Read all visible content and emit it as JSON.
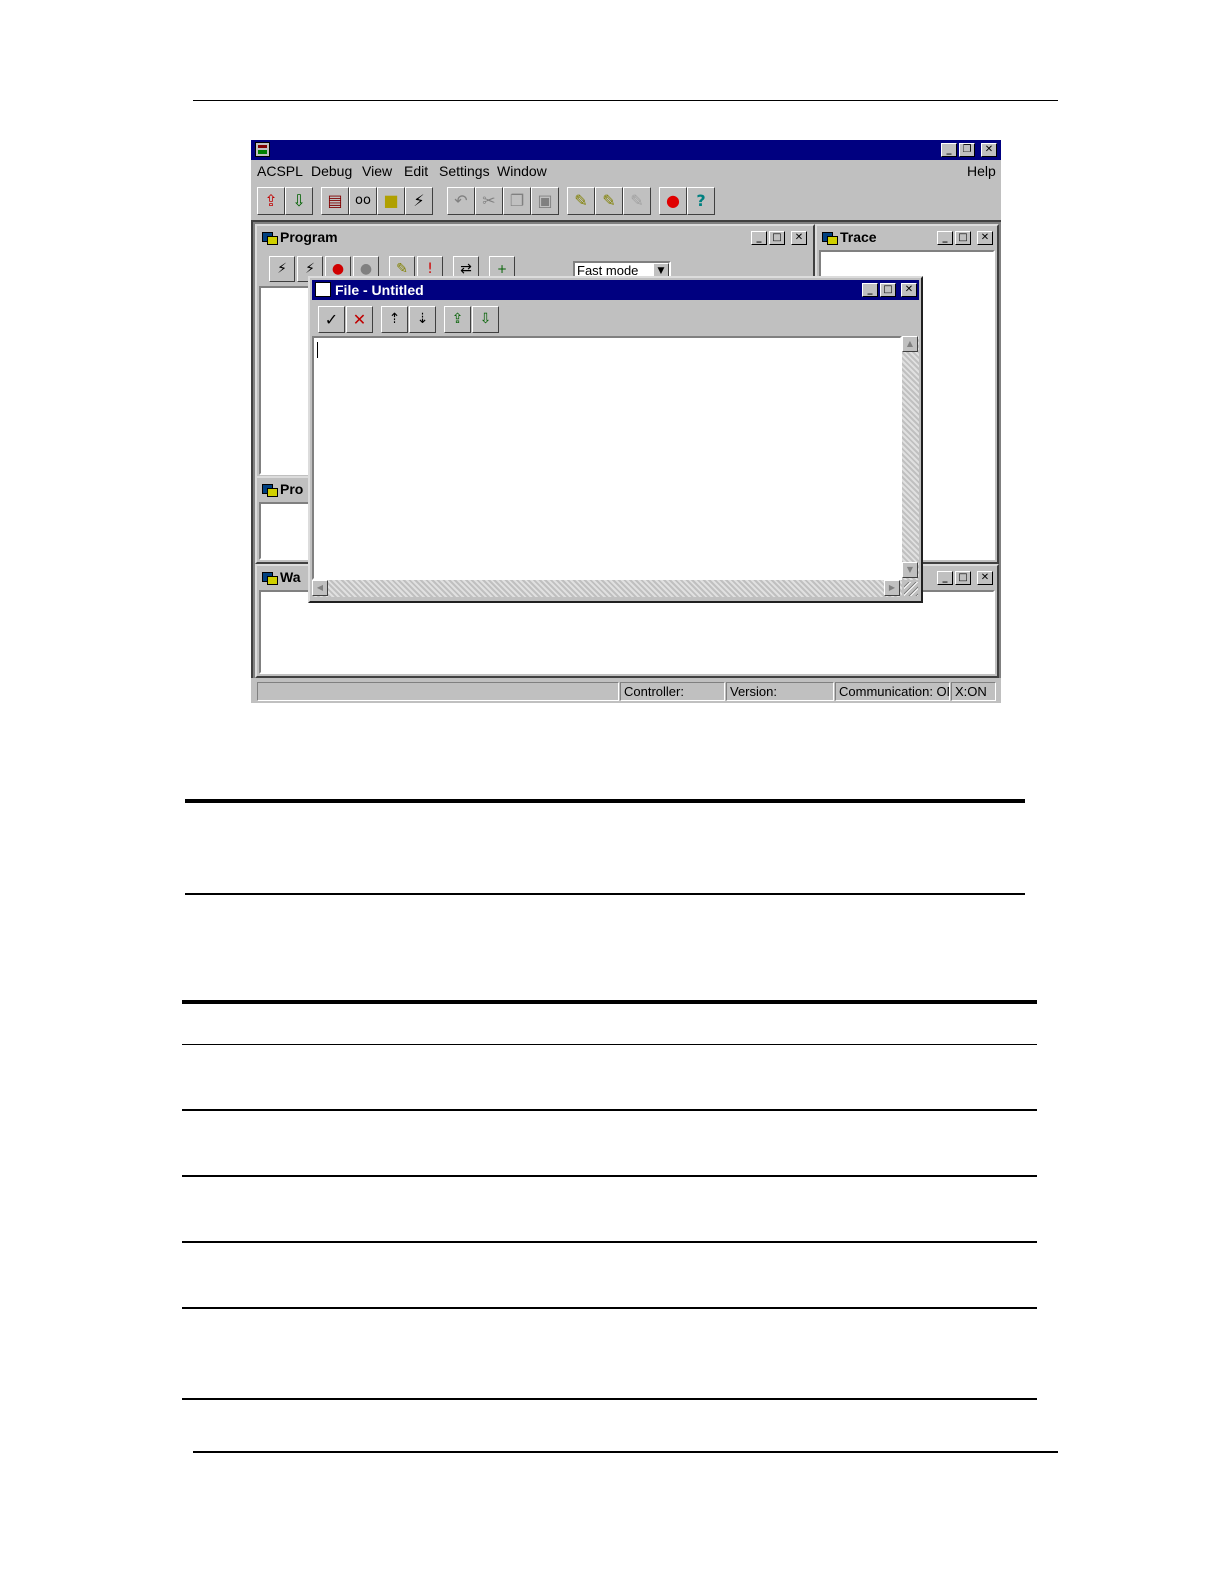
{
  "app": {
    "menu": [
      "ACSPL",
      "Debug",
      "View",
      "Edit",
      "Settings",
      "Window"
    ],
    "help": "Help",
    "window_buttons": {
      "minimize": "_",
      "restore": "❐",
      "close": "✕"
    }
  },
  "toolbar": {
    "icons": [
      "upload-icon",
      "download-icon",
      "calculator-icon",
      "glasses-icon",
      "note-icon",
      "lightning-icon",
      "undo-icon",
      "cut-icon",
      "copy-icon",
      "paste-icon",
      "find-icon",
      "replace-icon",
      "find-next-icon",
      "stop-alert-icon",
      "help-icon"
    ]
  },
  "windows": {
    "program": {
      "title": "Program",
      "mode": "Fast mode"
    },
    "trace": {
      "title": "Trace"
    },
    "program2": {
      "title": "Pro"
    },
    "watch": {
      "title": "Wa"
    },
    "file": {
      "title": "File - Untitled"
    }
  },
  "status": {
    "controller": "Controller:",
    "version": "Version:",
    "communication": "Communication: ON",
    "x": "X:ON"
  }
}
